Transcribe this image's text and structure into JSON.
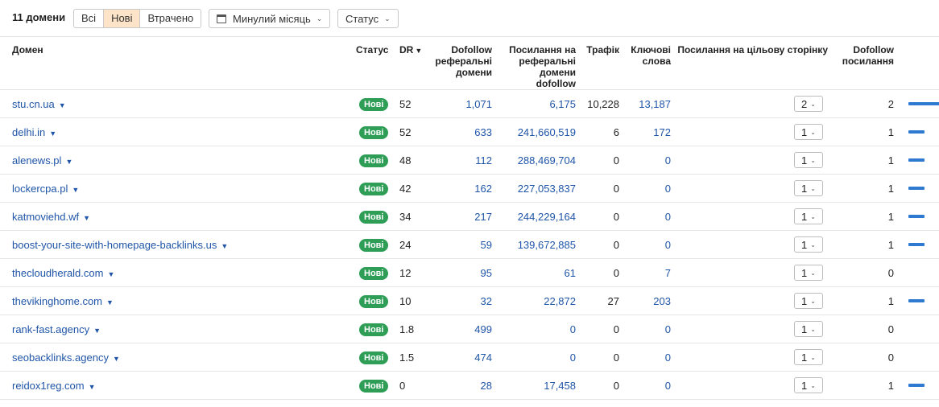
{
  "header": {
    "count_label": "11 домени",
    "filter_tabs": [
      {
        "label": "Всі",
        "active": false
      },
      {
        "label": "Нові",
        "active": true
      },
      {
        "label": "Втрачено",
        "active": false
      }
    ],
    "period_dropdown": "Минулий місяць",
    "status_dropdown": "Статус"
  },
  "columns": {
    "domain": "Домен",
    "status": "Статус",
    "dr": "DR",
    "dofollow_ref_domains": "Dofollow реферальні домени",
    "links_to_ref_domains": "Посилання на реферальні домени dofollow",
    "traffic": "Трафік",
    "keywords": "Ключові слова",
    "links_to_target": "Посилання на цільову сторінку",
    "dofollow_links": "Dofollow посилання"
  },
  "rows": [
    {
      "domain": "stu.cn.ua",
      "status": "Нові",
      "dr": "52",
      "ref": "1,071",
      "links": "6,175",
      "traffic": "10,228",
      "keywords": "13,187",
      "target": "2",
      "dofollow": "2",
      "bar": 1.0
    },
    {
      "domain": "delhi.in",
      "status": "Нові",
      "dr": "52",
      "ref": "633",
      "links": "241,660,519",
      "traffic": "6",
      "keywords": "172",
      "target": "1",
      "dofollow": "1",
      "bar": 0.5
    },
    {
      "domain": "alenews.pl",
      "status": "Нові",
      "dr": "48",
      "ref": "112",
      "links": "288,469,704",
      "traffic": "0",
      "keywords": "0",
      "target": "1",
      "dofollow": "1",
      "bar": 0.5
    },
    {
      "domain": "lockercpa.pl",
      "status": "Нові",
      "dr": "42",
      "ref": "162",
      "links": "227,053,837",
      "traffic": "0",
      "keywords": "0",
      "target": "1",
      "dofollow": "1",
      "bar": 0.5
    },
    {
      "domain": "katmoviehd.wf",
      "status": "Нові",
      "dr": "34",
      "ref": "217",
      "links": "244,229,164",
      "traffic": "0",
      "keywords": "0",
      "target": "1",
      "dofollow": "1",
      "bar": 0.5
    },
    {
      "domain": "boost-your-site-with-homepage-backlinks.us",
      "status": "Нові",
      "dr": "24",
      "ref": "59",
      "links": "139,672,885",
      "traffic": "0",
      "keywords": "0",
      "target": "1",
      "dofollow": "1",
      "bar": 0.5
    },
    {
      "domain": "thecloudherald.com",
      "status": "Нові",
      "dr": "12",
      "ref": "95",
      "links": "61",
      "traffic": "0",
      "keywords": "7",
      "target": "1",
      "dofollow": "0",
      "bar": 0
    },
    {
      "domain": "thevikinghome.com",
      "status": "Нові",
      "dr": "10",
      "ref": "32",
      "links": "22,872",
      "traffic": "27",
      "keywords": "203",
      "target": "1",
      "dofollow": "1",
      "bar": 0.5
    },
    {
      "domain": "rank-fast.agency",
      "status": "Нові",
      "dr": "1.8",
      "ref": "499",
      "links": "0",
      "traffic": "0",
      "keywords": "0",
      "target": "1",
      "dofollow": "0",
      "bar": 0
    },
    {
      "domain": "seobacklinks.agency",
      "status": "Нові",
      "dr": "1.5",
      "ref": "474",
      "links": "0",
      "traffic": "0",
      "keywords": "0",
      "target": "1",
      "dofollow": "0",
      "bar": 0
    },
    {
      "domain": "reidox1reg.com",
      "status": "Нові",
      "dr": "0",
      "ref": "28",
      "links": "17,458",
      "traffic": "0",
      "keywords": "0",
      "target": "1",
      "dofollow": "1",
      "bar": 0.5
    }
  ],
  "colors": {
    "accent_link": "#1f55a8",
    "badge_green": "#2e9e57",
    "active_tab": "#fde3c7",
    "bar_blue": "#2e7ad0"
  }
}
